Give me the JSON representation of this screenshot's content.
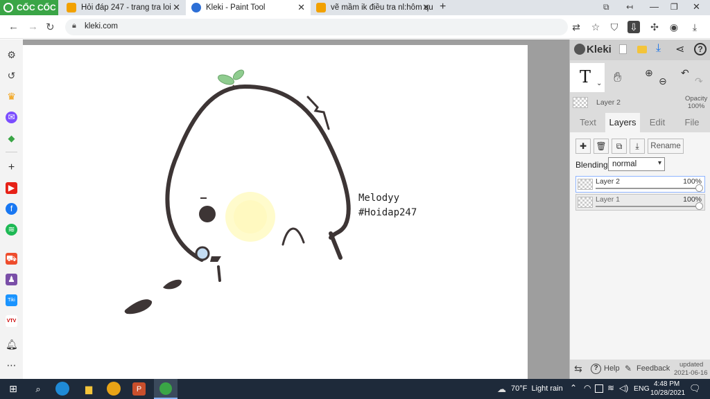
{
  "browser": {
    "brand": "CỐC CỐC",
    "tabs": [
      {
        "title": "Hỏi đáp 247 - trang tra loi"
      },
      {
        "title": "Kleki - Paint Tool"
      },
      {
        "title": "vẽ mầm ik điều tra nl:hôm qu"
      }
    ],
    "new_tab": "+",
    "url": "kleki.com"
  },
  "canvas": {
    "text_line1": "Melodyy",
    "text_line2": "#Hoidap247"
  },
  "panel": {
    "brand": "Kleki",
    "text_tool": "T",
    "active_layer_name": "Layer 2",
    "opacity_label": "Opacity",
    "opacity_value": "100%",
    "tabs": [
      "Text",
      "Layers",
      "Edit",
      "File"
    ],
    "rename_label": "Rename",
    "blending_label": "Blending",
    "blending_value": "normal",
    "layers": [
      {
        "name": "Layer 2",
        "opacity": "100%"
      },
      {
        "name": "Layer 1",
        "opacity": "100%"
      }
    ],
    "footer": {
      "help": "Help",
      "feedback": "Feedback",
      "updated_label": "updated",
      "updated_date": "2021-06-16"
    }
  },
  "taskbar": {
    "weather": "70°F  Light rain",
    "lang": "ENG",
    "time": "4:48 PM",
    "date": "10/28/2021"
  }
}
